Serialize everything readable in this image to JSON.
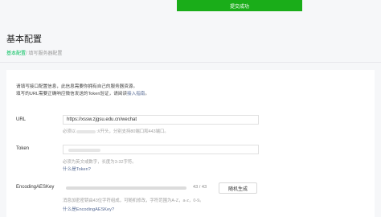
{
  "toast": {
    "text": "提交成功"
  },
  "page": {
    "title": "基本配置",
    "breadcrumb": {
      "parent": "基本配置",
      "separator": "/ ",
      "current": "填写服务器配置"
    }
  },
  "intro": {
    "line1": "请填写接口配置信息，此信息需要你拥有自己的服务器资源。",
    "line2_prefix": "填写的URL需要正确响应微信发送的Token验证，请阅读",
    "line2_link": "接入指南",
    "line2_suffix": "。"
  },
  "fields": {
    "url": {
      "label": "URL",
      "value": "https://xssw.zjgsu.edu.cn/wechat",
      "hint_prefix": "必须以",
      "hint_suffix": "://开头，分别支持80端口和443端口。"
    },
    "token": {
      "label": "Token",
      "hint": "必须为英文或数字，长度为3-32字符。",
      "help_link": "什么是Token?"
    },
    "aeskey": {
      "label": "EncodingAESKey",
      "counter": "43 / 43",
      "random_button": "随机生成",
      "hint": "消息加密密钥由43位字符组成，可随机修改，字符范围为A-Z，a-z，0-9。",
      "help_link": "什么是EncodingAESKey?"
    }
  },
  "colors": {
    "accent": "#1aad19",
    "link": "#576b95",
    "breadcrumb_link": "#07c160"
  }
}
